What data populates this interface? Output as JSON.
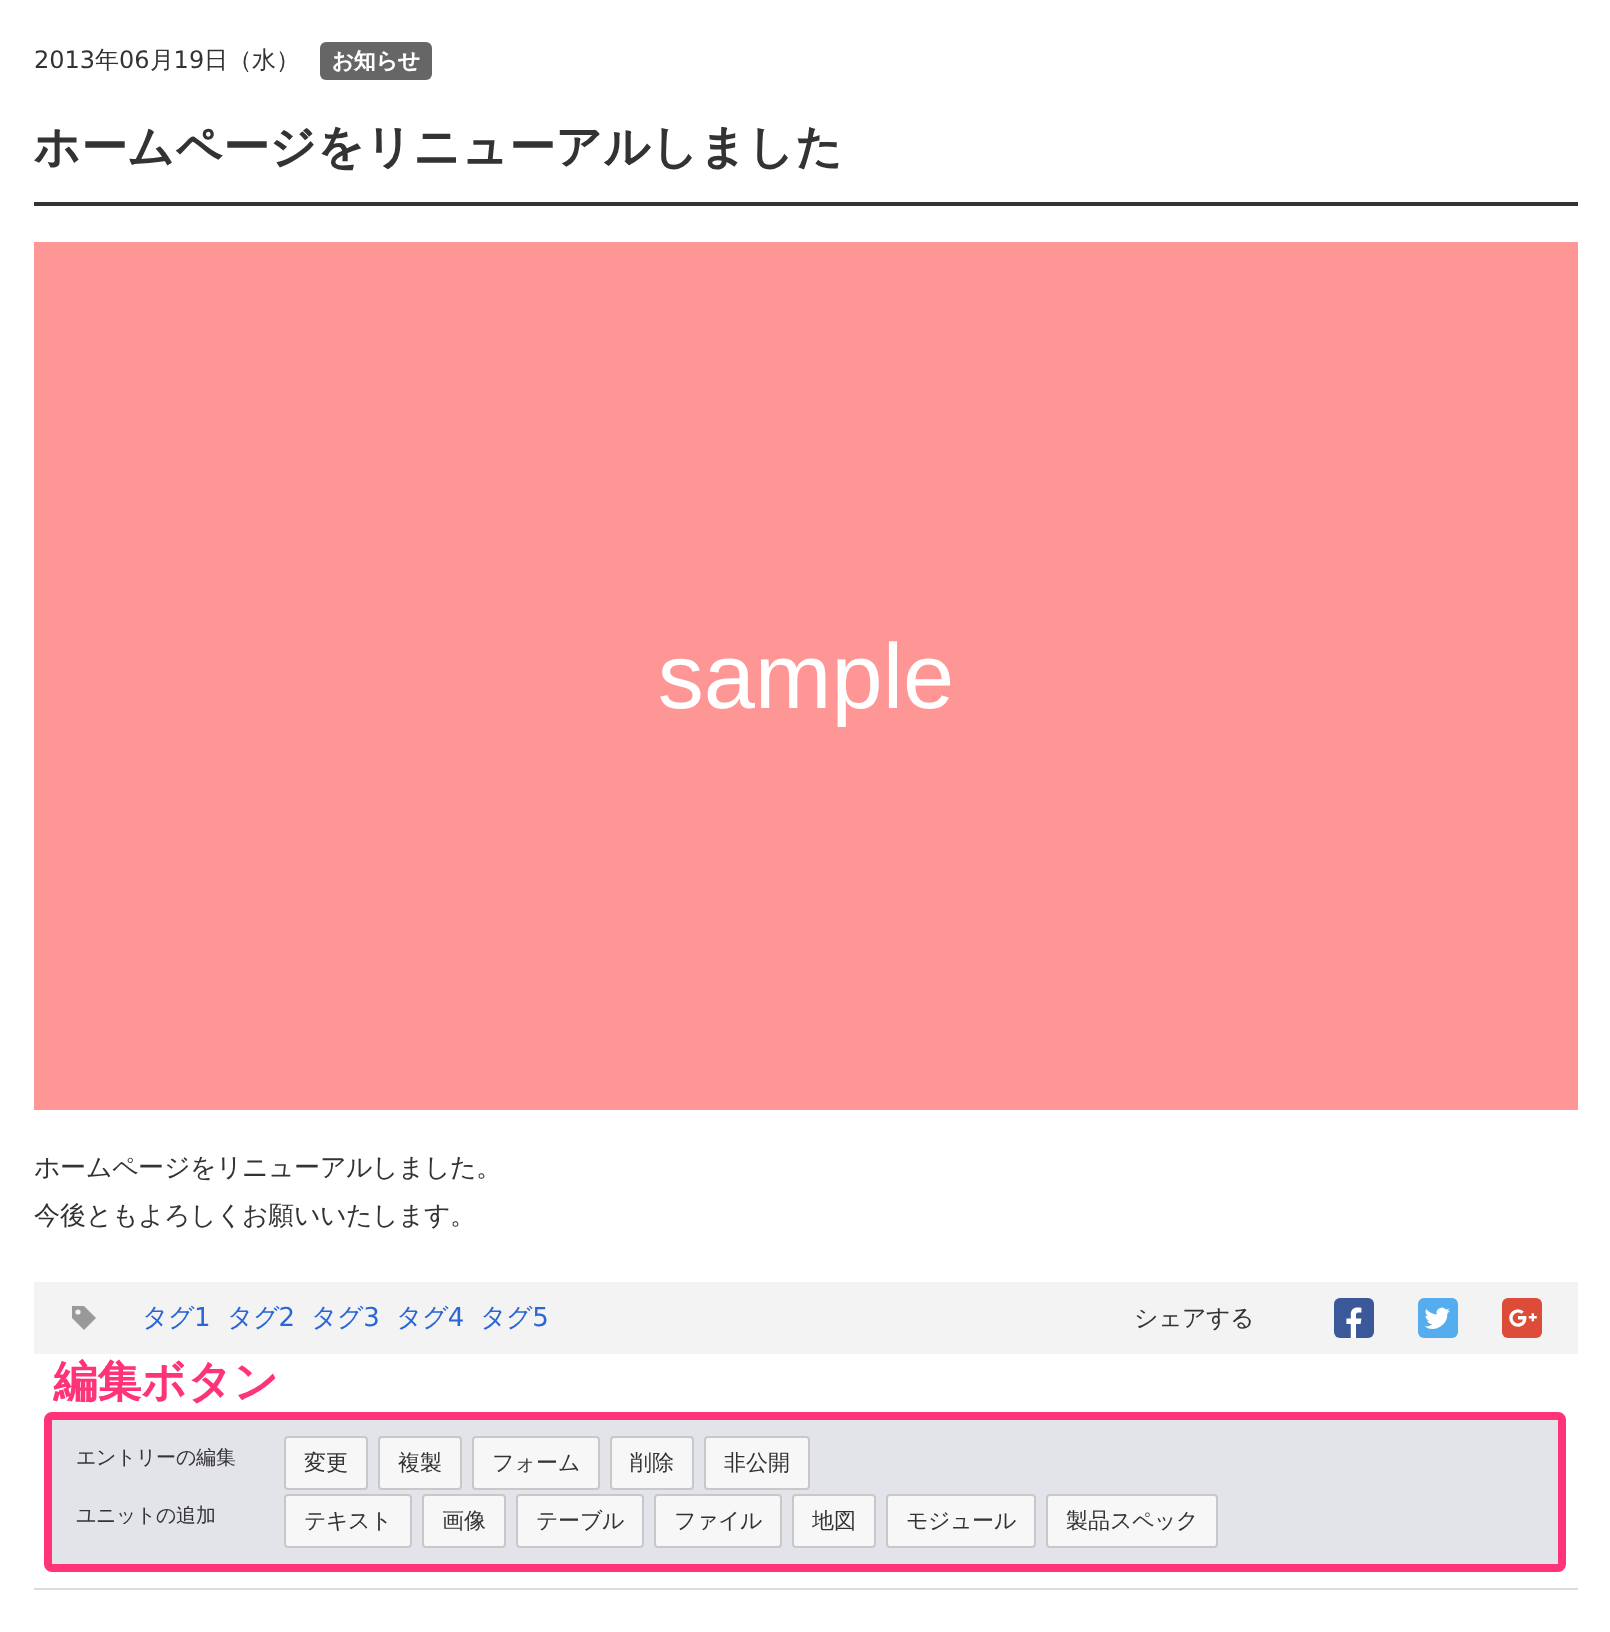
{
  "entry": {
    "date": "2013年06月19日（水）",
    "category": "お知らせ",
    "title": "ホームページをリニューアルしました"
  },
  "image": {
    "label": "sample"
  },
  "body": [
    "ホームページをリニューアルしました。",
    "今後ともよろしくお願いいたします。"
  ],
  "tags": [
    "タグ1",
    "タグ2",
    "タグ3",
    "タグ4",
    "タグ5"
  ],
  "share": {
    "label": "シェアする",
    "services": [
      {
        "kind": "facebook"
      },
      {
        "kind": "twitter"
      },
      {
        "kind": "googleplus"
      }
    ]
  },
  "annotation": "編集ボタン",
  "admin": [
    {
      "label": "エントリーの編集",
      "buttons": [
        "変更",
        "複製",
        "フォーム",
        "削除",
        "非公開"
      ]
    },
    {
      "label": "ユニットの追加",
      "buttons": [
        "テキスト",
        "画像",
        "テーブル",
        "ファイル",
        "地図",
        "モジュール",
        "製品スペック"
      ]
    }
  ]
}
